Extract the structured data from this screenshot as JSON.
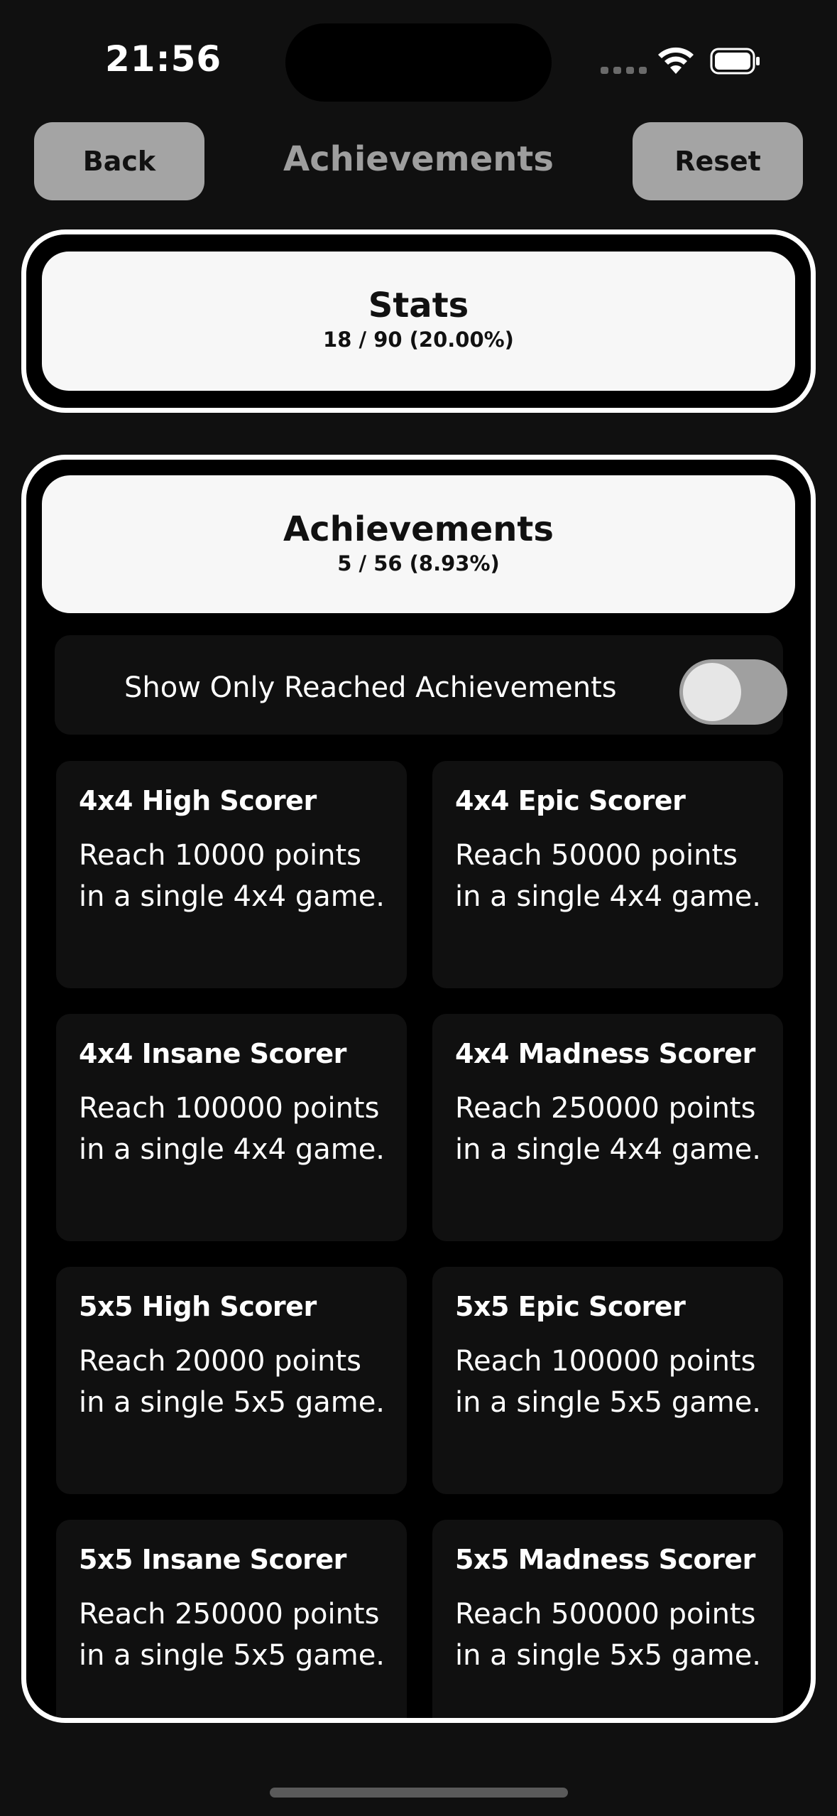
{
  "status_bar": {
    "time": "21:56"
  },
  "header": {
    "back_label": "Back",
    "title": "Achievements",
    "reset_label": "Reset"
  },
  "stats": {
    "title": "Stats",
    "progress": "18 / 90 (20.00%)"
  },
  "achievements": {
    "title": "Achievements",
    "progress": "5 / 56 (8.93%)",
    "toggle_label": "Show Only Reached Achievements",
    "toggle_on": false,
    "items": [
      {
        "name": "4x4 High Scorer",
        "desc": "Reach 10000 points in a single 4x4 game."
      },
      {
        "name": "4x4 Epic Scorer",
        "desc": "Reach 50000 points in a single 4x4 game."
      },
      {
        "name": "4x4 Insane Scorer",
        "desc": "Reach 100000 points in a single 4x4 game."
      },
      {
        "name": "4x4 Madness Scorer",
        "desc": "Reach 250000 points in a single 4x4 game."
      },
      {
        "name": "5x5 High Scorer",
        "desc": "Reach 20000 points in a single 5x5 game."
      },
      {
        "name": "5x5 Epic Scorer",
        "desc": "Reach 100000 points in a single 5x5 game."
      },
      {
        "name": "5x5 Insane Scorer",
        "desc": "Reach 250000 points in a single 5x5 game."
      },
      {
        "name": "5x5 Madness Scorer",
        "desc": "Reach 500000 points in a single 5x5 game."
      }
    ]
  },
  "icons": {
    "wifi": "wifi-icon",
    "battery": "battery-icon",
    "signal": "signal-icon"
  },
  "colors": {
    "background": "#101010",
    "button": "#a4a4a4",
    "card": "#f7f7f7"
  }
}
